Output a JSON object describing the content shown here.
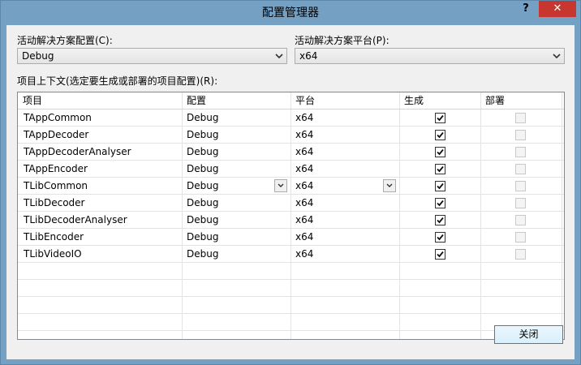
{
  "window": {
    "title": "配置管理器",
    "help_label": "?",
    "close_label": "✕"
  },
  "solution_config": {
    "label": "活动解决方案配置(C):",
    "value": "Debug"
  },
  "solution_platform": {
    "label": "活动解决方案平台(P):",
    "value": "x64"
  },
  "contexts": {
    "label": "项目上下文(选定要生成或部署的项目配置)(R):",
    "columns": [
      "项目",
      "配置",
      "平台",
      "生成",
      "部署"
    ],
    "rows": [
      {
        "project": "TAppCommon",
        "config": "Debug",
        "platform": "x64",
        "build": true,
        "deploy": false
      },
      {
        "project": "TAppDecoder",
        "config": "Debug",
        "platform": "x64",
        "build": true,
        "deploy": false
      },
      {
        "project": "TAppDecoderAnalyser",
        "config": "Debug",
        "platform": "x64",
        "build": true,
        "deploy": false
      },
      {
        "project": "TAppEncoder",
        "config": "Debug",
        "platform": "x64",
        "build": true,
        "deploy": false
      },
      {
        "project": "TLibCommon",
        "config": "Debug",
        "platform": "x64",
        "build": true,
        "deploy": false,
        "selected": true
      },
      {
        "project": "TLibDecoder",
        "config": "Debug",
        "platform": "x64",
        "build": true,
        "deploy": false
      },
      {
        "project": "TLibDecoderAnalyser",
        "config": "Debug",
        "platform": "x64",
        "build": true,
        "deploy": false
      },
      {
        "project": "TLibEncoder",
        "config": "Debug",
        "platform": "x64",
        "build": true,
        "deploy": false
      },
      {
        "project": "TLibVideoIO",
        "config": "Debug",
        "platform": "x64",
        "build": true,
        "deploy": false
      }
    ]
  },
  "footer": {
    "close_button": "关闭"
  },
  "colors": {
    "titlebar": "#73a0c3",
    "close_button": "#c7372f",
    "client": "#f0f0f0",
    "accent_border": "#3c7fb1"
  }
}
